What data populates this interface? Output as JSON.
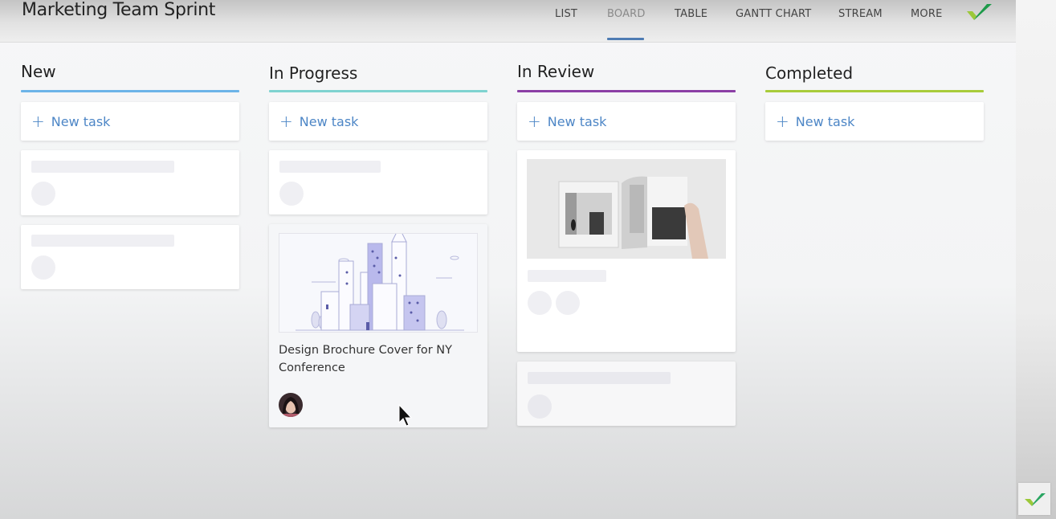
{
  "header": {
    "title": "Marketing Team Sprint",
    "tabs": [
      {
        "label": "LIST",
        "active": false
      },
      {
        "label": "BOARD",
        "active": true
      },
      {
        "label": "TABLE",
        "active": false
      },
      {
        "label": "GANTT CHART",
        "active": false
      },
      {
        "label": "STREAM",
        "active": false
      },
      {
        "label": "MORE",
        "active": false
      }
    ],
    "logo_icon": "checkmark-logo-icon"
  },
  "colors": {
    "new": "#6cb4e8",
    "in_progress": "#7fd3d0",
    "in_review": "#8b3fa5",
    "completed": "#a8cc3a",
    "link": "#4d86c6",
    "nav_active_underline": "#4f7cb3"
  },
  "columns": [
    {
      "title": "New",
      "new_task_label": "New task"
    },
    {
      "title": "In Progress",
      "new_task_label": "New task"
    },
    {
      "title": "In Review",
      "new_task_label": "New task"
    },
    {
      "title": "Completed",
      "new_task_label": "New task"
    }
  ],
  "cards": {
    "in_progress_task": {
      "title": "Design Brochure Cover for NY Conference",
      "image": "city-skyline-illustration",
      "assignee_avatar": "woman-avatar"
    },
    "in_review_task": {
      "image": "brochure-photo"
    }
  },
  "plus_symbol": "+",
  "fab_icon": "checkmark-icon"
}
